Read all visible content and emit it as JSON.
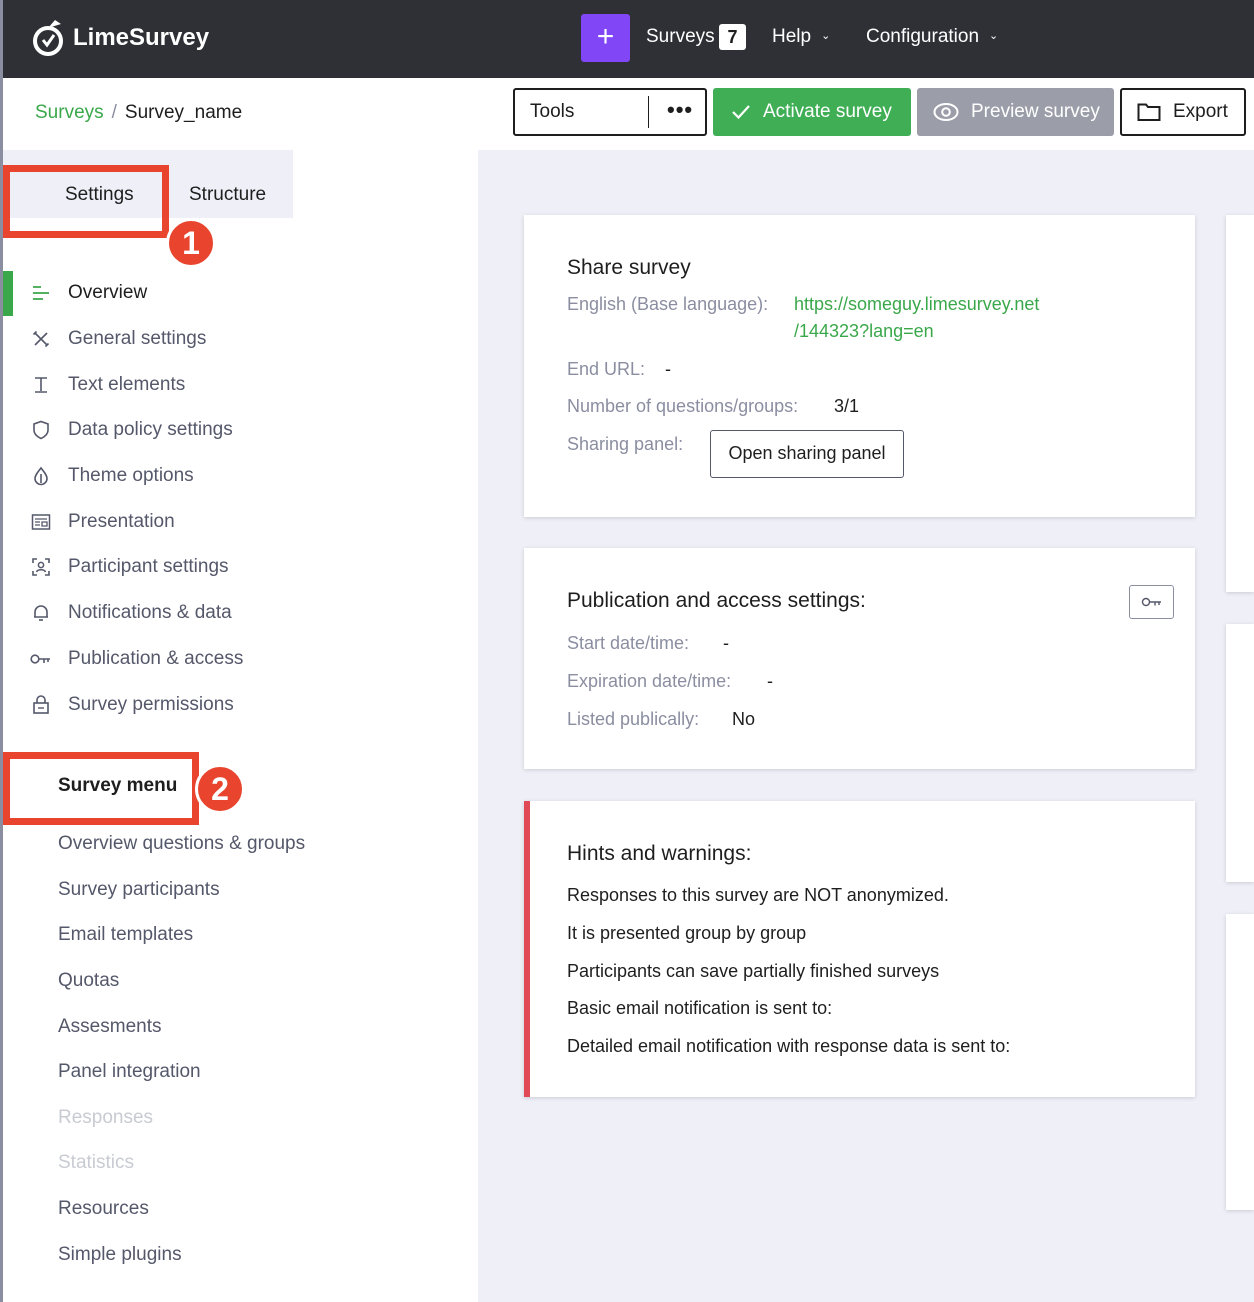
{
  "topbar": {
    "logo_text": "LimeSurvey",
    "add_label": "+",
    "surveys_label": "Surveys",
    "surveys_count": "7",
    "help_label": "Help",
    "config_label": "Configuration"
  },
  "breadcrumb": {
    "root": "Surveys",
    "separator": "/",
    "current": "Survey_name"
  },
  "toolbar": {
    "tools_label": "Tools",
    "tools_more": "•••",
    "activate_label": "Activate survey",
    "preview_label": "Preview survey",
    "export_label": "Export"
  },
  "tabs": {
    "settings": "Settings",
    "structure": "Structure"
  },
  "annotations": {
    "one": "1",
    "two": "2"
  },
  "settings_menu": [
    {
      "label": "Overview",
      "icon": "list-icon"
    },
    {
      "label": "General settings",
      "icon": "tools-icon"
    },
    {
      "label": "Text elements",
      "icon": "text-icon"
    },
    {
      "label": "Data policy settings",
      "icon": "shield-icon"
    },
    {
      "label": "Theme options",
      "icon": "drop-icon"
    },
    {
      "label": "Presentation",
      "icon": "presentation-icon"
    },
    {
      "label": "Participant settings",
      "icon": "participant-icon"
    },
    {
      "label": "Notifications & data",
      "icon": "bell-icon"
    },
    {
      "label": "Publication  & access",
      "icon": "key-icon"
    },
    {
      "label": "Survey permissions",
      "icon": "lock-icon"
    }
  ],
  "survey_menu": {
    "title": "Survey menu",
    "items": [
      "Overview questions & groups",
      "Survey participants",
      "Email templates",
      "Quotas",
      "Assesments",
      "Panel integration",
      "Responses",
      "Statistics",
      "Resources",
      "Simple plugins"
    ]
  },
  "share_card": {
    "title": "Share survey",
    "lang_label": "English (Base language):",
    "url_line1": "https://someguy.limesurvey.net",
    "url_line2": "/144323?lang=en",
    "end_url_label": "End URL:",
    "end_url_value": "-",
    "count_label": "Number of questions/groups:",
    "count_value": "3/1",
    "sharing_label": "Sharing panel:",
    "sharing_button": "Open sharing panel"
  },
  "publication_card": {
    "title": "Publication and access settings:",
    "start_label": "Start date/time:",
    "start_value": "-",
    "expiry_label": "Expiration date/time:",
    "expiry_value": "-",
    "listed_label": "Listed publically:",
    "listed_value": "No"
  },
  "hints_card": {
    "title": "Hints and warnings:",
    "lines": [
      "Responses to this survey are NOT anonymized.",
      "It is presented group by group",
      "Participants can save partially finished surveys",
      "Basic email notification is sent to:",
      "Detailed email notification with response data is sent to:"
    ]
  },
  "colors": {
    "accent_green": "#3aa84a",
    "brand_purple": "#8146f6",
    "topbar": "#2e3036",
    "highlight_red": "#e8442e",
    "warning_red": "#e04a55"
  }
}
